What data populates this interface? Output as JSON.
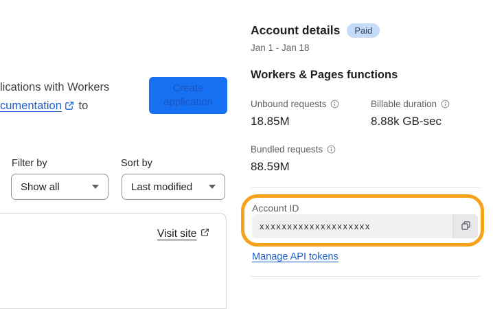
{
  "colors": {
    "accent_blue": "#1570F2",
    "button_text_blue": "#1D55BE",
    "link_blue": "#1B60D1",
    "badge_bg": "#C6DAFA",
    "badge_text": "#2E3F5E",
    "highlight_orange": "#F7A21C",
    "input_bg": "#F1F1F2"
  },
  "left_panel": {
    "intro_line1": "lications with Workers",
    "intro_link_label": "cumentation",
    "intro_tail": "to",
    "create_button_label": "Create application",
    "filter": {
      "label": "Filter by",
      "value": "Show all"
    },
    "sort": {
      "label": "Sort by",
      "value": "Last modified"
    },
    "card": {
      "visit_site_label": "Visit site"
    }
  },
  "account_panel": {
    "title": "Account details",
    "badge": "Paid",
    "date_range": "Jan 1 - Jan 18",
    "section_title": "Workers & Pages functions",
    "stats": [
      {
        "label": "Unbound requests",
        "value": "18.85M"
      },
      {
        "label": "Billable duration",
        "value": "8.88k GB-sec"
      },
      {
        "label": "Bundled requests",
        "value": "88.59M"
      }
    ],
    "account_id": {
      "label": "Account ID",
      "value": "xxxxxxxxxxxxxxxxxxxx"
    },
    "manage_tokens_label": "Manage API tokens"
  }
}
